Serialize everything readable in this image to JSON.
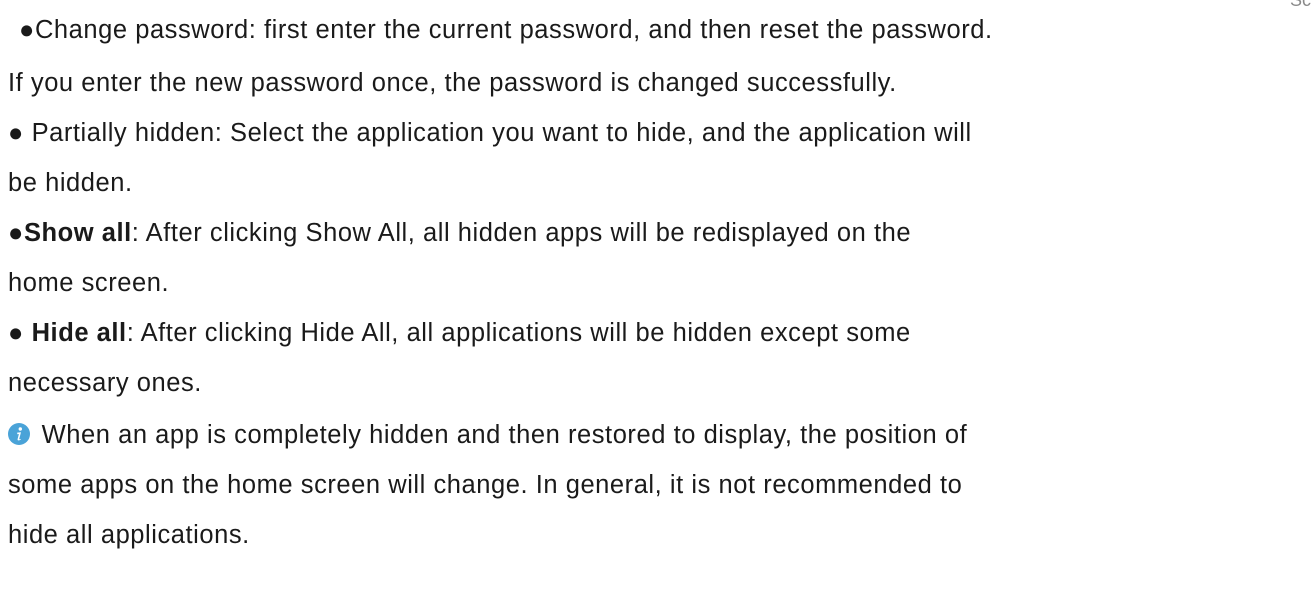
{
  "corner_mark": "Sc",
  "bullet": "●",
  "change_password": {
    "line1": "●Change password: first enter the current password, and then reset the password.",
    "line2": "If you enter the new password once, the password is changed successfully."
  },
  "partially_hidden": {
    "line1": "● Partially hidden: Select the application you want to hide, and the application will",
    "line2": "be hidden."
  },
  "show_all": {
    "term": "Show all",
    "rest": ": After clicking Show All, all hidden apps will be redisplayed on the",
    "line2": "home screen."
  },
  "hide_all": {
    "prefix": "● ",
    "term": "Hide all",
    "rest": ": After clicking Hide All, all applications will be hidden except some",
    "line2": "necessary ones."
  },
  "note": {
    "icon": "info-icon",
    "icon_color": "#4aa3d8",
    "line1": " When an app is completely hidden and then restored to display, the position of",
    "line2": "some apps on the home screen will change. In general, it is not recommended to",
    "line3": "hide all applications."
  }
}
